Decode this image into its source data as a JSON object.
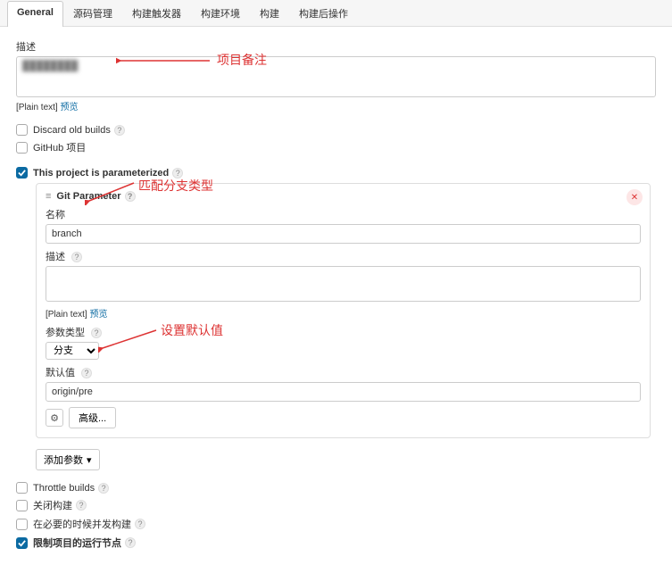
{
  "tabs": {
    "t0": "General",
    "t1": "源码管理",
    "t2": "构建触发器",
    "t3": "构建环境",
    "t4": "构建",
    "t5": "构建后操作"
  },
  "desc": {
    "label": "描述",
    "value": "",
    "plain": "[Plain text]",
    "preview": "预览"
  },
  "checks": {
    "discard": "Discard old builds",
    "github": "GitHub 项目",
    "parameterized": "This project is parameterized",
    "throttle": "Throttle builds",
    "disable": "关闭构建",
    "concurrent": "在必要的时候并发构建",
    "restrict": "限制项目的运行节点"
  },
  "param": {
    "title": "Git Parameter",
    "name_label": "名称",
    "name_value": "branch",
    "desc_label": "描述",
    "desc_value": "",
    "plain": "[Plain text]",
    "preview": "预览",
    "type_label": "参数类型",
    "type_value": "分支",
    "default_label": "默认值",
    "default_value": "origin/pre",
    "advanced": "高级..."
  },
  "add_param": "添加参数",
  "annotations": {
    "a1": "项目备注",
    "a2": "匹配分支类型",
    "a3": "设置默认值"
  }
}
